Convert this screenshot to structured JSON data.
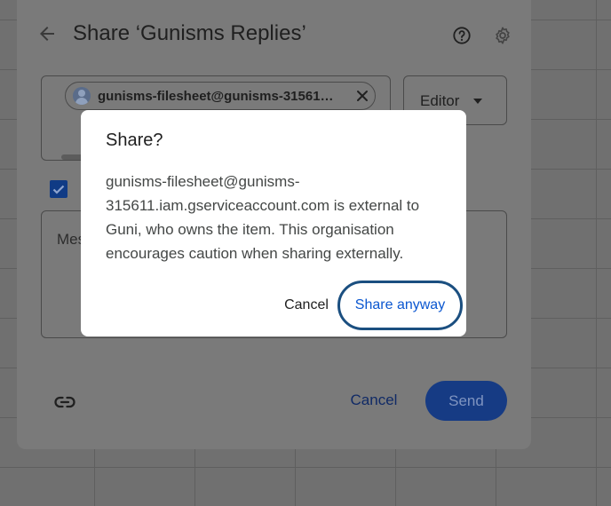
{
  "share_dialog": {
    "title": "Share ‘Gunisms Replies’",
    "recipient_chip": "gunisms-filesheet@gunisms-31561…",
    "role": "Editor",
    "notify_checked": true,
    "message_placeholder": "Mes",
    "cancel_label": "Cancel",
    "send_label": "Send"
  },
  "confirm_dialog": {
    "title": "Share?",
    "body": "gunisms-filesheet@gunisms-315611.iam.gserviceaccount.com is external to Guni, who owns the item. This organisation encourages caution when sharing externally.",
    "cancel_label": "Cancel",
    "confirm_label": "Share anyway"
  },
  "icons": {
    "back": "arrow-back",
    "help": "help-circle",
    "settings": "gear",
    "chip_close": "close",
    "link": "link"
  },
  "colors": {
    "accent": "#0b57d0",
    "focus_ring": "#1b4f80",
    "send_button": "#163b84"
  }
}
